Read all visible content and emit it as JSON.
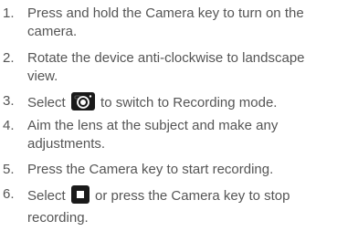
{
  "steps": [
    {
      "number": "1.",
      "text": "Press and hold the Camera key to turn on the camera."
    },
    {
      "number": "2.",
      "text": "Rotate the device anti-clockwise to landscape view."
    },
    {
      "number": "3.",
      "before": "Select",
      "after": "to switch to Recording mode.",
      "icon": "camera-switch-icon"
    },
    {
      "number": "4.",
      "text": "Aim the lens at the subject and make any adjustments."
    },
    {
      "number": "5.",
      "text": "Press the Camera key to start recording."
    },
    {
      "number": "6.",
      "before": "Select",
      "after": "or press the Camera key to stop recording.",
      "icon": "stop-icon"
    }
  ]
}
